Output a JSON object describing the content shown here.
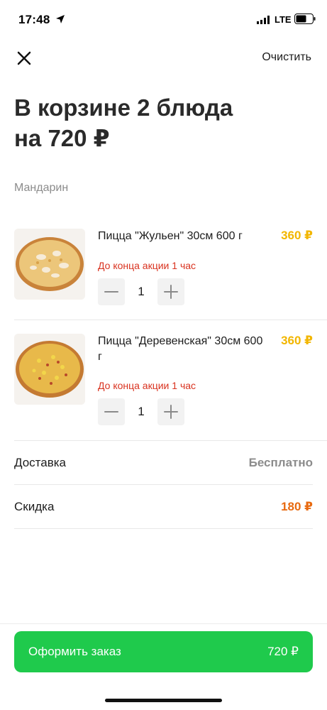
{
  "status_bar": {
    "time": "17:48",
    "network": "LTE",
    "icons": [
      "location-arrow-icon",
      "signal-icon",
      "battery-icon"
    ]
  },
  "header": {
    "close_icon": "close-icon",
    "clear_label": "Очистить"
  },
  "title": {
    "line1": "В корзине 2 блюда",
    "line2": "на 720 ₽"
  },
  "restaurant": "Мандарин",
  "items": [
    {
      "name": "Пицца \"Жульен\" 30см 600 г",
      "price": "360 ₽",
      "promo": "До конца акции 1 час",
      "quantity": "1",
      "image": "pizza-julienne-image"
    },
    {
      "name": "Пицца \"Деревенская\" 30см 600 г",
      "price": "360 ₽",
      "promo": "До конца акции 1 час",
      "quantity": "1",
      "image": "pizza-country-image"
    }
  ],
  "summary": {
    "delivery_label": "Доставка",
    "delivery_value": "Бесплатно",
    "discount_label": "Скидка",
    "discount_value": "180 ₽"
  },
  "checkout": {
    "label": "Оформить заказ",
    "total": "720 ₽"
  },
  "colors": {
    "price": "#f2b600",
    "promo": "#d9321f",
    "discount": "#e86a10",
    "checkout_button": "#1fca4c"
  }
}
